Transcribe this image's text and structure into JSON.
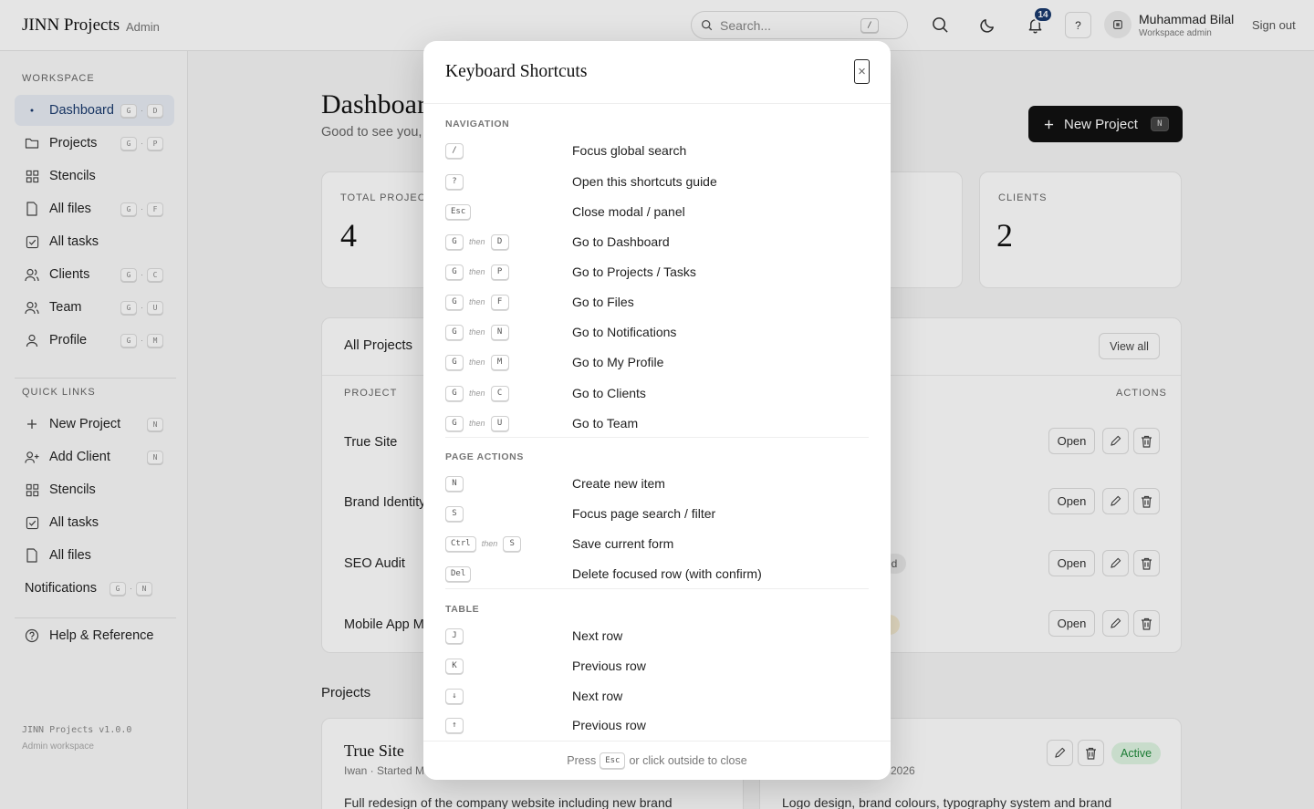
{
  "header": {
    "brand": "JINN Projects",
    "brand_sub": "Admin",
    "search_placeholder": "Search...",
    "search_shortcut": "/",
    "notification_count": "14",
    "help_label": "?",
    "user_name": "Muhammad Bilal",
    "user_role": "Workspace admin",
    "sign_out": "Sign out"
  },
  "sidebar": {
    "workspace_label": "WORKSPACE",
    "workspace_items": [
      {
        "label": "Dashboard",
        "icon": "dot-icon",
        "keys": [
          "G",
          "D"
        ]
      },
      {
        "label": "Projects",
        "icon": "folder-icon",
        "keys": [
          "G",
          "P"
        ]
      },
      {
        "label": "Stencils",
        "icon": "grid-icon",
        "keys": []
      },
      {
        "label": "All files",
        "icon": "file-icon",
        "keys": [
          "G",
          "F"
        ]
      },
      {
        "label": "All tasks",
        "icon": "checkbox-icon",
        "keys": []
      },
      {
        "label": "Clients",
        "icon": "users-icon",
        "keys": [
          "G",
          "C"
        ]
      },
      {
        "label": "Team",
        "icon": "team-icon",
        "keys": [
          "G",
          "U"
        ]
      },
      {
        "label": "Profile",
        "icon": "user-icon",
        "keys": [
          "G",
          "M"
        ]
      }
    ],
    "quick_label": "QUICK LINKS",
    "quick_items": [
      {
        "label": "New Project",
        "icon": "plus-icon",
        "keys": [
          "N"
        ]
      },
      {
        "label": "Add Client",
        "icon": "user-plus-icon",
        "keys": [
          "N"
        ]
      },
      {
        "label": "Stencils",
        "icon": "grid-icon",
        "keys": []
      },
      {
        "label": "All tasks",
        "icon": "checkbox-icon",
        "keys": []
      },
      {
        "label": "All files",
        "icon": "file-icon",
        "keys": []
      },
      {
        "label": "Notifications",
        "icon": "",
        "keys": [
          "G",
          "N"
        ]
      }
    ],
    "help_item": "Help & Reference",
    "version": "JINN Projects v1.0.0",
    "workspace_note": "Admin workspace"
  },
  "main": {
    "title": "Dashboar",
    "subtitle": "Good to see you, I",
    "new_project_label": "New Project",
    "new_project_key": "N",
    "stats": [
      {
        "label": "TOTAL PROJECT",
        "value": "4"
      },
      {
        "label": "CLIENTS",
        "value": "2"
      }
    ],
    "table_title": "All Projects",
    "view_all": "View all",
    "col_project": "PROJECT",
    "col_actions": "ACTIONS",
    "rows": [
      {
        "name": "True Site"
      },
      {
        "name": "Brand Identity"
      },
      {
        "name": "SEO Audit"
      },
      {
        "name": "Mobile App MV"
      }
    ],
    "open_label": "Open",
    "status_fragment": "ed",
    "projects_heading": "Projects",
    "card1": {
      "title": "True Site",
      "meta": "Iwan · Started M",
      "desc": "Full redesign of the company website including new brand"
    },
    "card2": {
      "meta": "2026",
      "desc": "Logo design, brand colours, typography system and brand",
      "status": "Active"
    }
  },
  "modal": {
    "title": "Keyboard Shortcuts",
    "close": "×",
    "then": "then",
    "sections": [
      {
        "label": "NAVIGATION",
        "rows": [
          {
            "keys": [
              "/"
            ],
            "desc": "Focus global search"
          },
          {
            "keys": [
              "?"
            ],
            "desc": "Open this shortcuts guide"
          },
          {
            "keys": [
              "Esc"
            ],
            "desc": "Close modal / panel"
          },
          {
            "keys": [
              "G",
              "D"
            ],
            "desc": "Go to Dashboard"
          },
          {
            "keys": [
              "G",
              "P"
            ],
            "desc": "Go to Projects / Tasks"
          },
          {
            "keys": [
              "G",
              "F"
            ],
            "desc": "Go to Files"
          },
          {
            "keys": [
              "G",
              "N"
            ],
            "desc": "Go to Notifications"
          },
          {
            "keys": [
              "G",
              "M"
            ],
            "desc": "Go to My Profile"
          },
          {
            "keys": [
              "G",
              "C"
            ],
            "desc": "Go to Clients"
          },
          {
            "keys": [
              "G",
              "U"
            ],
            "desc": "Go to Team"
          }
        ]
      },
      {
        "label": "PAGE ACTIONS",
        "rows": [
          {
            "keys": [
              "N"
            ],
            "desc": "Create new item"
          },
          {
            "keys": [
              "S"
            ],
            "desc": "Focus page search / filter"
          },
          {
            "keys": [
              "Ctrl",
              "S"
            ],
            "desc": "Save current form"
          },
          {
            "keys": [
              "Del"
            ],
            "desc": "Delete focused row (with confirm)"
          }
        ]
      },
      {
        "label": "TABLE",
        "rows": [
          {
            "keys": [
              "J"
            ],
            "desc": "Next row"
          },
          {
            "keys": [
              "K"
            ],
            "desc": "Previous row"
          },
          {
            "keys": [
              "↓"
            ],
            "desc": "Next row"
          },
          {
            "keys": [
              "↑"
            ],
            "desc": "Previous row"
          }
        ]
      }
    ],
    "footer_press": "Press",
    "footer_key": "Esc",
    "footer_rest": "or click outside to close"
  },
  "colors": {
    "accent": "#1a3a6e",
    "active_bg": "#e8edf4",
    "primary_button": "#111111",
    "success": "#1f8a3a"
  }
}
